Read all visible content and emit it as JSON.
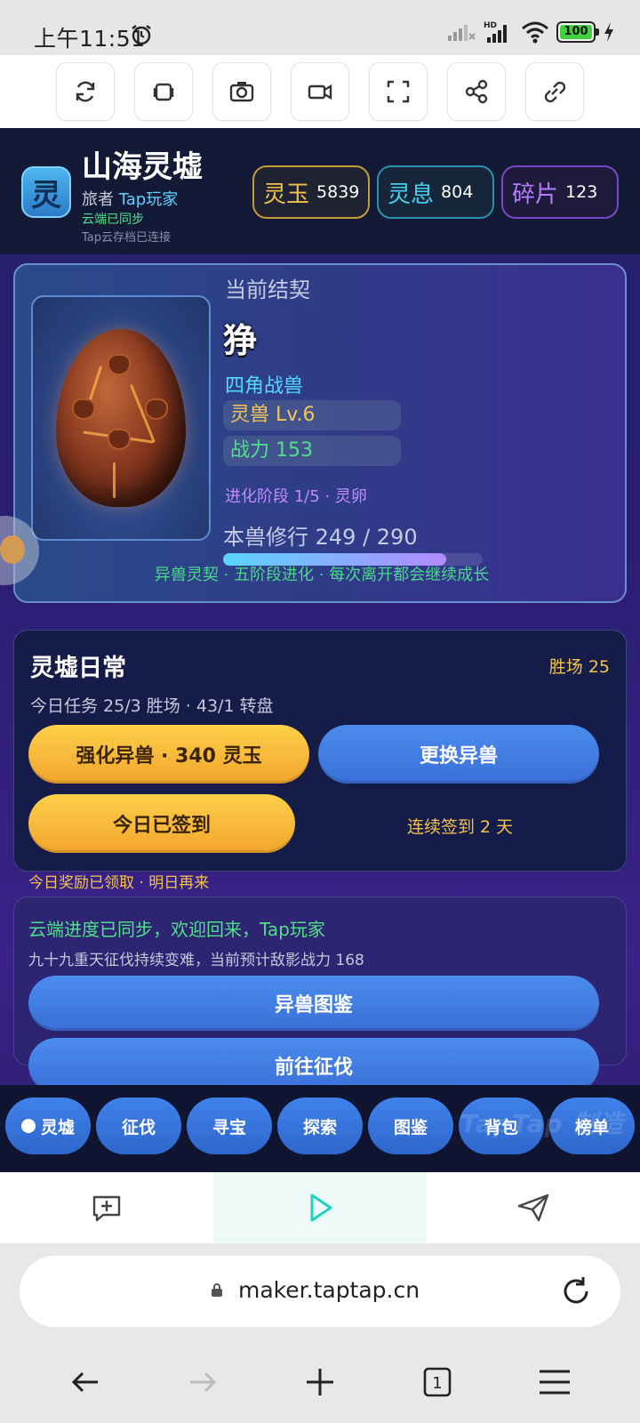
{
  "status_bar": {
    "time": "上午11:51",
    "battery": "100",
    "icons": [
      "alarm-icon",
      "signal-weak-icon",
      "hd-signal-icon",
      "wifi-icon",
      "battery-icon",
      "charging-icon"
    ]
  },
  "toolbar": {
    "buttons": [
      "refresh-icon",
      "layers-icon",
      "camera-icon",
      "video-icon",
      "fullscreen-icon",
      "share-icon",
      "link-icon"
    ]
  },
  "game": {
    "logo_char": "灵",
    "title": "山海灵墟",
    "player_prefix": "旅者",
    "player_name": "Tap玩家",
    "sync_status": "云端已同步",
    "save_status": "Tap云存档已连接",
    "resources": [
      {
        "label": "灵玉",
        "value": "5839"
      },
      {
        "label": "灵息",
        "value": "804"
      },
      {
        "label": "碎片",
        "value": "123"
      }
    ],
    "beast": {
      "bind_label": "当前结契",
      "name": "狰",
      "species": "四角战兽",
      "level": "灵兽 Lv.6",
      "power": "战力 153",
      "evolve": "进化阶段 1/5 · 灵卵",
      "training": "本兽修行 249 / 290",
      "training_progress": 0.8586,
      "footer": "异兽灵契 · 五阶段进化 · 每次离开都会继续成长"
    },
    "daily": {
      "title": "灵墟日常",
      "wins": "胜场 25",
      "tasks": "今日任务 25/3 胜场 · 43/1 转盘",
      "enhance_button": "强化异兽 · 340 灵玉",
      "switch_button": "更换异兽",
      "checkin_button": "今日已签到",
      "streak": "连续签到 2 天",
      "reward_note": "今日奖励已领取 · 明日再来"
    },
    "sync_card": {
      "title": "云端进度已同步，欢迎回来，Tap玩家",
      "subtitle": "九十九重天征伐持续变难，当前预计敌影战力 168",
      "codex_button": "异兽图鉴",
      "expedition_button": "前往征伐"
    },
    "nav": [
      "灵墟",
      "征伐",
      "寻宝",
      "探索",
      "图鉴",
      "背包",
      "榜单"
    ],
    "watermark": "TapTap 制造"
  },
  "action_bar": {
    "icons": [
      "feedback-icon",
      "play-icon",
      "send-icon"
    ]
  },
  "browser": {
    "url": "maker.taptap.cn",
    "tab_count": "1",
    "nav_icons": [
      "back-arrow-icon",
      "forward-arrow-icon",
      "new-tab-icon",
      "tabs-icon",
      "menu-icon"
    ]
  },
  "colors": {
    "accent_gold": "#f2c24c",
    "accent_cyan": "#54d6ff",
    "accent_green": "#4fe08a",
    "accent_purple": "#c28aff",
    "button_blue": "#3f82ea"
  }
}
